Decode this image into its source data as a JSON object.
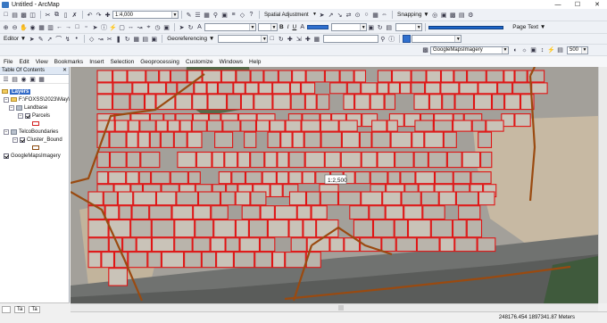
{
  "window": {
    "title": "Untitled - ArcMap"
  },
  "standard_toolbar": {
    "scale": "1:4,000"
  },
  "spatial_adjustment": {
    "label": "Spatial Adjustment"
  },
  "snapping": {
    "label": "Snapping"
  },
  "page_text": {
    "label": "Page Text"
  },
  "editor": {
    "label": "Editor"
  },
  "georeferencing": {
    "label": "Georeferencing",
    "layer": "GoogleMapsImagery",
    "value": "500"
  },
  "menu": [
    "File",
    "Edit",
    "View",
    "Bookmarks",
    "Insert",
    "Selection",
    "Geoprocessing",
    "Customize",
    "Windows",
    "Help"
  ],
  "toc": {
    "title": "Table Of Contents",
    "root": "Layers",
    "path": "F:\\FOXSS\\2023\\May\\",
    "groups": [
      {
        "name": "Landbase",
        "layers": [
          {
            "name": "Parcels",
            "checked": true
          }
        ]
      },
      {
        "name": "TelcoBoundaries",
        "layers": [
          {
            "name": "Cluster_Bound",
            "checked": true
          }
        ]
      }
    ],
    "imagery": {
      "name": "GoogleMapsImagery",
      "checked": true
    },
    "tabs": [
      "",
      "Ta",
      "Ta"
    ]
  },
  "map": {
    "label_marker": "1:2,500",
    "colors": {
      "parcel_outline": "#e01515",
      "boundary": "#9a4a10",
      "ground": "#a3a09a"
    }
  },
  "status": {
    "coords": "248176.454  1897341.87 Meters"
  }
}
